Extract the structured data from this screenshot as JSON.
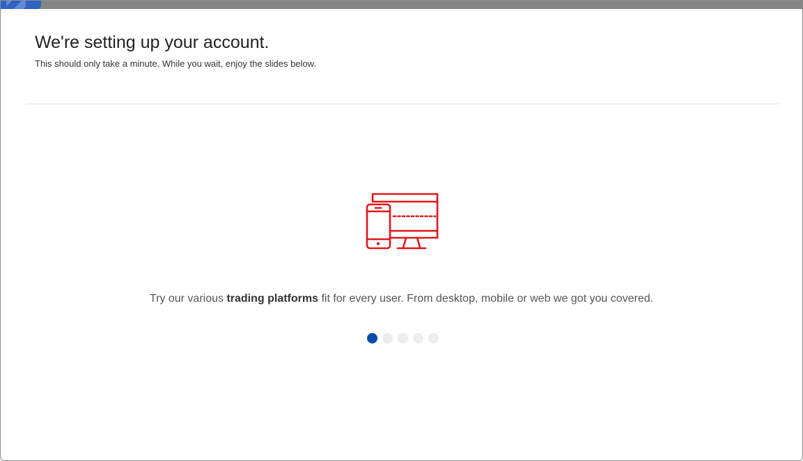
{
  "progress": {
    "fraction": 0.05,
    "fill_color": "#2f63c4",
    "track_color": "#858585"
  },
  "header": {
    "title": "We're setting up your account.",
    "subtitle": "This should only take a minute. While you wait, enjoy the slides below."
  },
  "slide": {
    "icon": "devices-icon",
    "icon_color": "#e3161b",
    "caption_before": "Try our various ",
    "caption_bold": "trading platforms",
    "caption_after": " fit for every user. From desktop, mobile or web we got you covered."
  },
  "pagination": {
    "total": 5,
    "active_index": 0,
    "active_color": "#0b4aa8",
    "inactive_color": "#ededed"
  }
}
